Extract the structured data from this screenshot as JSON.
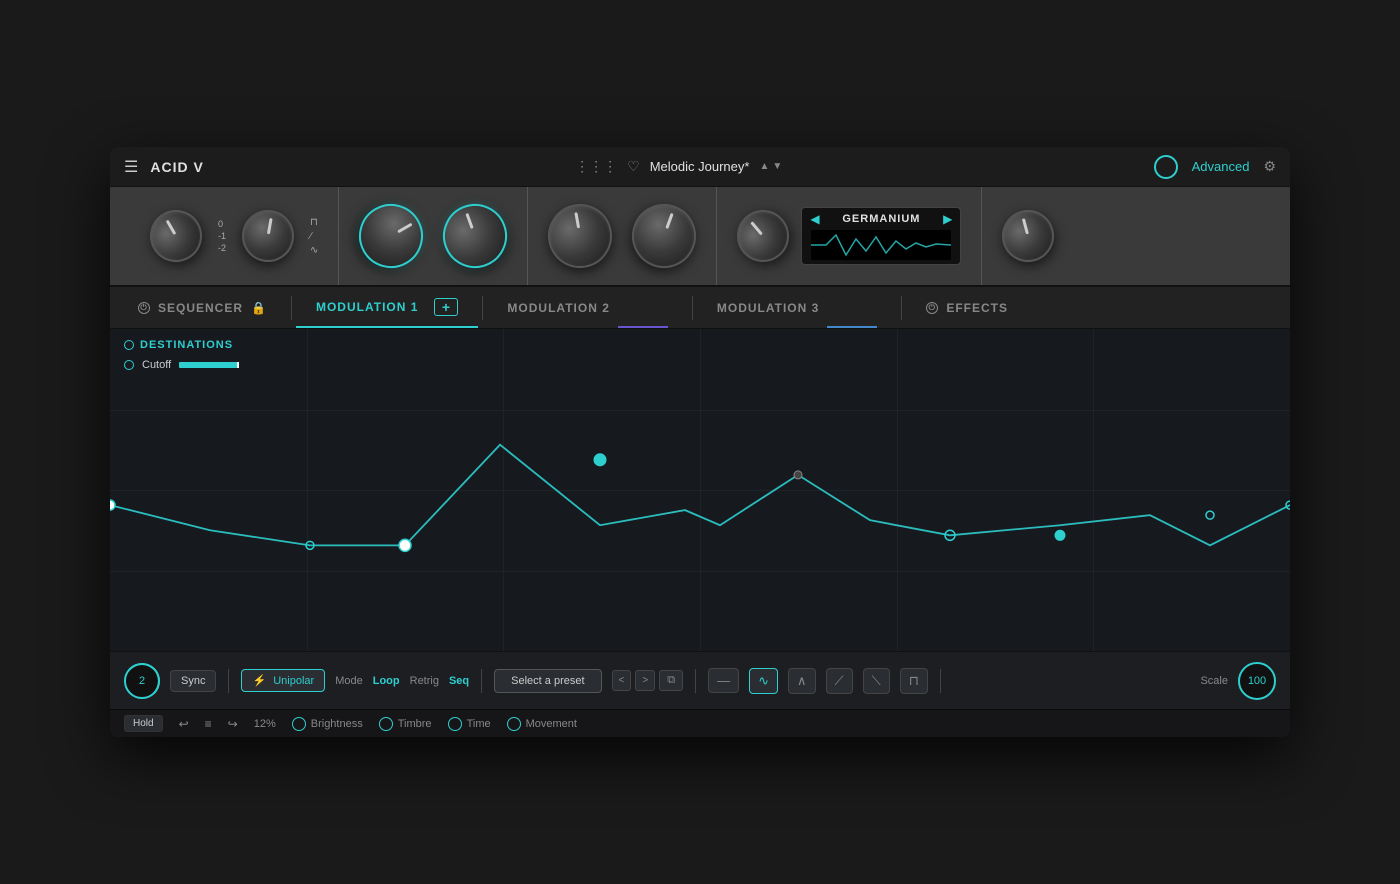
{
  "app": {
    "title": "ACID V",
    "preset_name": "Melodic Journey*",
    "advanced_label": "Advanced"
  },
  "tabs": {
    "sequencer": "SEQUENCER",
    "mod1": "MODULATION 1",
    "mod2": "MODULATION 2",
    "mod3": "MODULATION 3",
    "effects": "EFFECTS"
  },
  "destinations": {
    "title": "DESTINATIONS",
    "items": [
      {
        "label": "Cutoff"
      }
    ]
  },
  "bottom": {
    "steps": "2",
    "sync_label": "Sync",
    "unipolar_label": "Unipolar",
    "mode_label": "Mode",
    "mode_value": "Loop",
    "retrig_label": "Retrig",
    "seq_label": "Seq",
    "select_preset_label": "Select a preset",
    "scale_label": "Scale",
    "scale_value": "100"
  },
  "status_bar": {
    "hold_label": "Hold",
    "percent": "12%",
    "brightness_label": "Brightness",
    "timbre_label": "Timbre",
    "time_label": "Time",
    "movement_label": "Movement"
  },
  "effect": {
    "name": "GERMANIUM"
  }
}
